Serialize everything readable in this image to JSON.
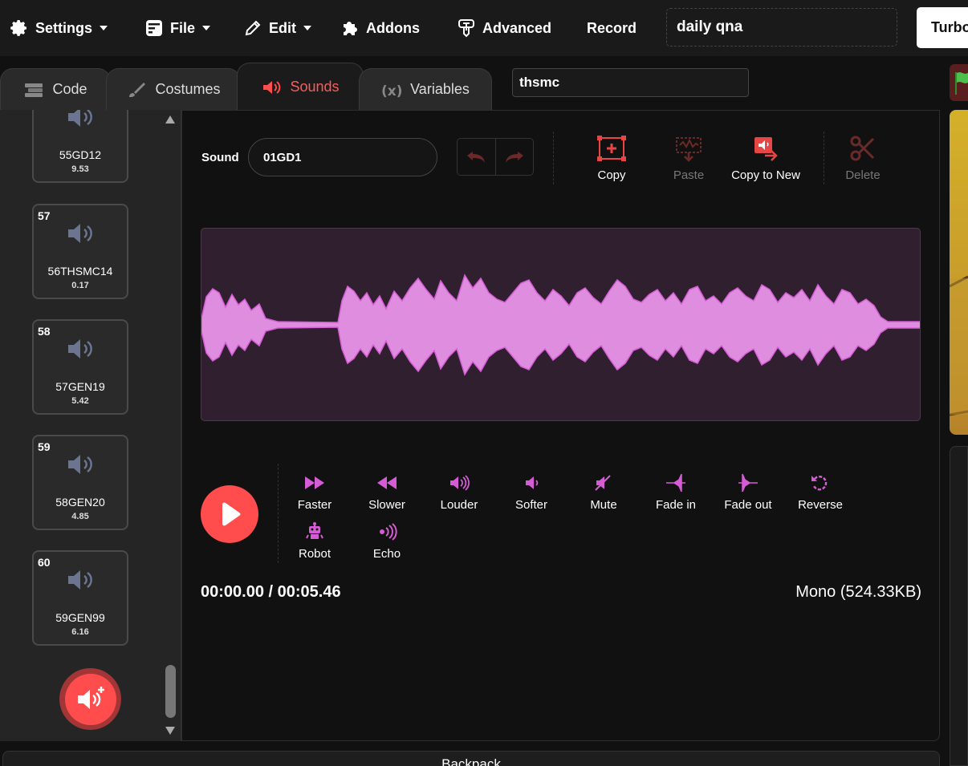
{
  "menu": {
    "settings": "Settings",
    "file": "File",
    "edit": "Edit",
    "addons": "Addons",
    "advanced": "Advanced",
    "record": "Record",
    "project_title": "daily qna",
    "turbo_label": "Turbo"
  },
  "tabs": [
    {
      "label": "Code"
    },
    {
      "label": "Costumes"
    },
    {
      "label": "Sounds",
      "active": true
    },
    {
      "label": "Variables"
    }
  ],
  "sprite_name": "thsmc",
  "sounds": [
    {
      "number": "",
      "name": "55GD12",
      "duration": "9.53"
    },
    {
      "number": "57",
      "name": "56THSMC14",
      "duration": "0.17"
    },
    {
      "number": "58",
      "name": "57GEN19",
      "duration": "5.42"
    },
    {
      "number": "59",
      "name": "58GEN20",
      "duration": "4.85"
    },
    {
      "number": "60",
      "name": "59GEN99",
      "duration": "6.16"
    }
  ],
  "editor": {
    "sound_label": "Sound",
    "sound_name": "01GD1",
    "tools": {
      "copy": "Copy",
      "paste": "Paste",
      "copy_to_new": "Copy to New",
      "delete": "Delete"
    },
    "effects": {
      "faster": "Faster",
      "slower": "Slower",
      "louder": "Louder",
      "softer": "Softer",
      "mute": "Mute",
      "fade_in": "Fade in",
      "fade_out": "Fade out",
      "reverse": "Reverse",
      "robot": "Robot",
      "echo": "Echo"
    },
    "time": "00:00.00 / 00:05.46",
    "format": "Mono (524.33KB)"
  },
  "backpack_label": "Backpack",
  "colors": {
    "accent": "#ff4c4c",
    "waveform": "#de8ddf",
    "effect_icon": "#d65cd6"
  }
}
